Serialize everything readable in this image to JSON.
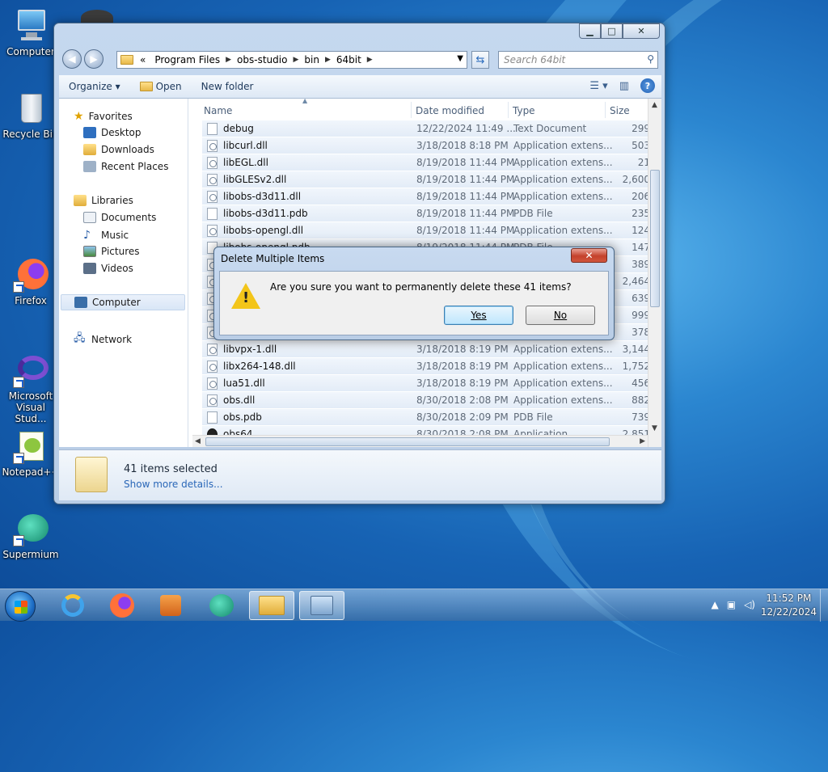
{
  "desktop": {
    "icons": [
      {
        "label": "Computer"
      },
      {
        "label": "Recycle Bin"
      },
      {
        "label": "Firefox"
      },
      {
        "label": "Microsoft Visual Stud..."
      },
      {
        "label": "Notepad++"
      },
      {
        "label": "Supermium"
      }
    ]
  },
  "explorer": {
    "address": [
      "«",
      "Program Files",
      "obs-studio",
      "bin",
      "64bit"
    ],
    "search_placeholder": "Search 64bit",
    "commands": {
      "organize": "Organize ▾",
      "open": "Open",
      "new_folder": "New folder"
    },
    "nav": {
      "favorites": "Favorites",
      "desktop": "Desktop",
      "downloads": "Downloads",
      "recent_places": "Recent Places",
      "libraries": "Libraries",
      "documents": "Documents",
      "music": "Music",
      "pictures": "Pictures",
      "videos": "Videos",
      "computer": "Computer",
      "network": "Network"
    },
    "columns": {
      "name": "Name",
      "date": "Date modified",
      "type": "Type",
      "size": "Size"
    },
    "files": [
      {
        "name": "debug",
        "date": "12/22/2024 11:49 ...",
        "type": "Text Document",
        "size": "299",
        "icon": "txt"
      },
      {
        "name": "libcurl.dll",
        "date": "3/18/2018 8:18 PM",
        "type": "Application extens...",
        "size": "503",
        "icon": "dll"
      },
      {
        "name": "libEGL.dll",
        "date": "8/19/2018 11:44 PM",
        "type": "Application extens...",
        "size": "21",
        "icon": "dll"
      },
      {
        "name": "libGLESv2.dll",
        "date": "8/19/2018 11:44 PM",
        "type": "Application extens...",
        "size": "2,600",
        "icon": "dll"
      },
      {
        "name": "libobs-d3d11.dll",
        "date": "8/19/2018 11:44 PM",
        "type": "Application extens...",
        "size": "206",
        "icon": "dll"
      },
      {
        "name": "libobs-d3d11.pdb",
        "date": "8/19/2018 11:44 PM",
        "type": "PDB File",
        "size": "235",
        "icon": "txt"
      },
      {
        "name": "libobs-opengl.dll",
        "date": "8/19/2018 11:44 PM",
        "type": "Application extens...",
        "size": "124",
        "icon": "dll"
      },
      {
        "name": "libobs-opengl.pdb",
        "date": "8/19/2018 11:44 PM",
        "type": "PDB File",
        "size": "147",
        "icon": "txt"
      },
      {
        "name": "",
        "date": "",
        "type": "",
        "size": "389",
        "icon": "dll"
      },
      {
        "name": "",
        "date": "",
        "type": "",
        "size": "2,464",
        "icon": "dll"
      },
      {
        "name": "",
        "date": "",
        "type": "",
        "size": "639",
        "icon": "dll"
      },
      {
        "name": "",
        "date": "",
        "type": "",
        "size": "999",
        "icon": "dll"
      },
      {
        "name": "",
        "date": "",
        "type": "",
        "size": "378",
        "icon": "dll"
      },
      {
        "name": "libvpx-1.dll",
        "date": "3/18/2018 8:19 PM",
        "type": "Application extens...",
        "size": "3,144",
        "icon": "dll"
      },
      {
        "name": "libx264-148.dll",
        "date": "3/18/2018 8:19 PM",
        "type": "Application extens...",
        "size": "1,752",
        "icon": "dll"
      },
      {
        "name": "lua51.dll",
        "date": "3/18/2018 8:19 PM",
        "type": "Application extens...",
        "size": "456",
        "icon": "dll"
      },
      {
        "name": "obs.dll",
        "date": "8/30/2018 2:08 PM",
        "type": "Application extens...",
        "size": "882",
        "icon": "dll"
      },
      {
        "name": "obs.pdb",
        "date": "8/30/2018 2:09 PM",
        "type": "PDB File",
        "size": "739",
        "icon": "txt"
      },
      {
        "name": "obs64",
        "date": "8/30/2018 2:08 PM",
        "type": "Application",
        "size": "2,851",
        "icon": "app"
      }
    ],
    "details": {
      "selected": "41 items selected",
      "more": "Show more details..."
    }
  },
  "dialog": {
    "title": "Delete Multiple Items",
    "message": "Are you sure you want to permanently delete these 41 items?",
    "yes": "Yes",
    "no": "No"
  },
  "taskbar": {
    "time": "11:52 PM",
    "date": "12/22/2024"
  }
}
